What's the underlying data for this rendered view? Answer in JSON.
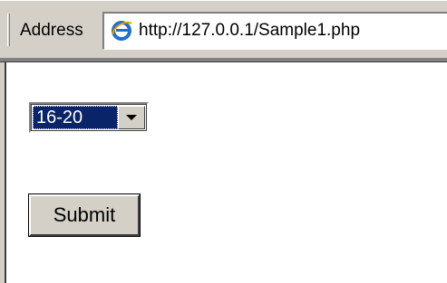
{
  "toolbar": {
    "address_label": "Address",
    "url": "http://127.0.0.1/Sample1.php",
    "icon": "internet-explorer-icon"
  },
  "form": {
    "select_value": "16-20",
    "submit_label": "Submit"
  },
  "colors": {
    "chrome": "#d4d0c8",
    "selection": "#0a246a",
    "ie_icon": "#1f6fd1"
  }
}
